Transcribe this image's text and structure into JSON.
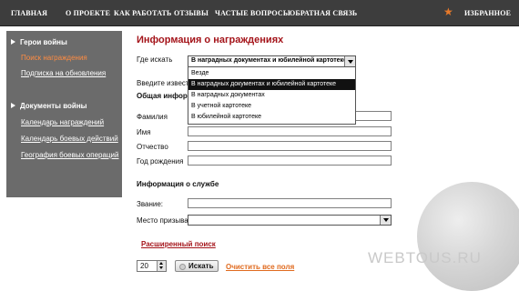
{
  "nav": {
    "items": [
      "ГЛАВНАЯ",
      "О ПРОЕКТЕ",
      "КАК РАБОТАТЬ",
      "ОТЗЫВЫ",
      "ЧАСТЫЕ ВОПРОСЫ",
      "ОБРАТНАЯ СВЯЗЬ"
    ],
    "favorites": "ИЗБРАННОЕ",
    "star_icon": "star-icon"
  },
  "sidebar": {
    "section1": {
      "title": "Герои войны",
      "links": [
        "Поиск награждения",
        "Подписка на обновления"
      ],
      "active_index": 0
    },
    "section2": {
      "title": "Документы войны",
      "links": [
        "Календарь награждений",
        "Календарь боевых действий",
        "География боевых операций"
      ]
    }
  },
  "main": {
    "title": "Информация о награждениях",
    "where_label": "Где искать",
    "where_value": "В наградных документах и юбилейной картотеке",
    "enter_label": "Введите известн",
    "general_label": "Общая информац",
    "dropdown_options": [
      "Везде",
      "В наградных документах и юбилейной картотеке",
      "В наградных документах",
      "В учетной картотеке",
      "В юбилейной картотеке"
    ],
    "dropdown_selected_index": 1,
    "fields": [
      "Фамилия",
      "Имя",
      "Отчество",
      "Год рождения"
    ],
    "service_title": "Информация о службе",
    "rank_label": "Звание:",
    "conscription_label": "Место призыва:",
    "advanced_link": "Расширенный поиск",
    "per_page": "20",
    "search_button": "Искать",
    "clear_link": "Очистить все поля"
  },
  "watermark": "WEBTOUS.RU",
  "colors": {
    "nav_bg": "#3d3d3d",
    "sidebar_bg": "#6b6b6b",
    "title_red": "#a4141a",
    "active_orange": "#ff8c42",
    "clear_orange": "#e06a1e"
  }
}
